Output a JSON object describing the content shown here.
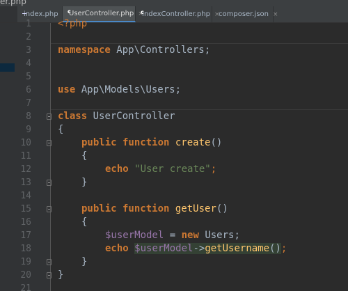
{
  "crumb": {
    "text": "er.php"
  },
  "tabs": [
    {
      "label": "index.php",
      "icon": "php-file-icon",
      "active": false
    },
    {
      "label": "UserController.php",
      "icon": "php-class-icon",
      "active": true
    },
    {
      "label": "IndexController.php",
      "icon": "php-class-icon",
      "active": false
    },
    {
      "label": "composer.json",
      "icon": "json-file-icon",
      "active": false
    }
  ],
  "tab_close": "×",
  "editor": {
    "line_numbers": [
      "1",
      "2",
      "3",
      "4",
      "5",
      "6",
      "7",
      "8",
      "9",
      "10",
      "11",
      "12",
      "13",
      "14",
      "15",
      "16",
      "17",
      "18",
      "19",
      "20",
      "21"
    ],
    "lines": {
      "l1": {
        "open": "<?php"
      },
      "l3": {
        "kw": "namespace",
        "rest": " App\\Controllers;"
      },
      "l6": {
        "kw": "use",
        "rest": " App\\Models\\Users;"
      },
      "l8": {
        "kw": "class",
        "rest": " UserController"
      },
      "l9": {
        "brace": "{"
      },
      "l10": {
        "kw": "public function",
        "fn": "create",
        "rest": "()"
      },
      "l11": {
        "brace": "{"
      },
      "l12": {
        "kw": "echo",
        "str": "\"User create\"",
        "end": ";"
      },
      "l13": {
        "brace": "}"
      },
      "l15": {
        "kw": "public function",
        "fn": "getUser",
        "rest": "()"
      },
      "l16": {
        "brace": "{"
      },
      "l17": {
        "var": "$userModel",
        "op": " = ",
        "kw": "new",
        "rest": " Users;"
      },
      "l18": {
        "kw": "echo",
        "var": "$userModel",
        "arrow": "->",
        "fn": "getUsername",
        "call": "()",
        "end": ";"
      },
      "l19": {
        "brace": "}"
      },
      "l20": {
        "brace": "}"
      }
    }
  },
  "colors": {
    "keyword": "#cc7832",
    "string": "#6a8759",
    "variable": "#9876aa",
    "default": "#a9b7c6",
    "background": "#2b2b2b"
  }
}
